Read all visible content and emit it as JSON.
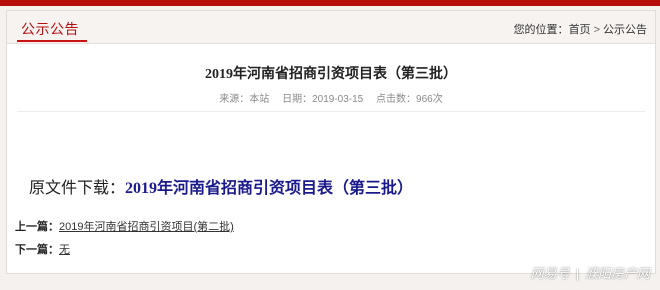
{
  "header": {
    "section_title": "公示公告",
    "breadcrumb": {
      "prefix": "您的位置：",
      "home": "首页",
      "separator": ">",
      "current": "公示公告"
    }
  },
  "article": {
    "title": "2019年河南省招商引资项目表（第三批）",
    "meta": {
      "source": "来源：本站",
      "date": "日期：2019-03-15",
      "views": "点击数：966次"
    },
    "download_label": "原文件下载：",
    "download_link": "2019年河南省招商引资项目表（第三批）"
  },
  "navigation": {
    "prev_label": "上一篇：",
    "prev_link": "2019年河南省招商引资项目(第二批)",
    "next_label": "下一篇：",
    "next_link": "无"
  },
  "watermark": {
    "brand": "网易号",
    "divider": "|",
    "account": "濮阳房产网"
  },
  "colors": {
    "accent_red": "#b80d0d",
    "link_blue": "#1a1a8c"
  }
}
